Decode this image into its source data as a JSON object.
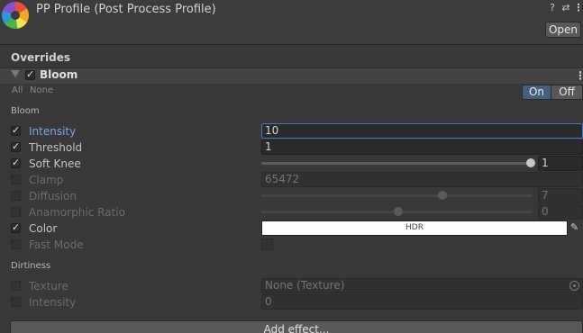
{
  "header": {
    "title": "PP Profile (Post Process Profile)",
    "open_label": "Open",
    "icons": [
      "help-icon",
      "settings-sliders-icon",
      "kebab-menu-icon"
    ]
  },
  "overrides_label": "Overrides",
  "effect": {
    "name": "Bloom",
    "enabled": true,
    "all_label": "All",
    "none_label": "None",
    "on_label": "On",
    "off_label": "Off",
    "state": "On"
  },
  "sections": {
    "bloom": "Bloom",
    "dirtiness": "Dirtiness"
  },
  "bloom_props": {
    "intensity": {
      "label": "Intensity",
      "value": "10",
      "checked": true
    },
    "threshold": {
      "label": "Threshold",
      "value": "1",
      "checked": true
    },
    "soft_knee": {
      "label": "Soft Knee",
      "value": "1",
      "checked": true,
      "slider_fraction": 1.0
    },
    "clamp": {
      "label": "Clamp",
      "value": "65472",
      "checked": false
    },
    "diffusion": {
      "label": "Diffusion",
      "value": "7",
      "checked": false,
      "slider_fraction": 0.667
    },
    "anamorphic": {
      "label": "Anamorphic Ratio",
      "value": "0",
      "checked": false,
      "slider_fraction": 0.5
    },
    "color": {
      "label": "Color",
      "value": "HDR",
      "checked": true,
      "swatch": "#ffffff"
    },
    "fast_mode": {
      "label": "Fast Mode",
      "checked": false
    }
  },
  "dirt_props": {
    "texture": {
      "label": "Texture",
      "value": "None (Texture)",
      "checked": false
    },
    "intensity": {
      "label": "Intensity",
      "value": "0",
      "checked": false
    }
  },
  "add_effect_label": "Add effect...",
  "colors": {
    "background": "#383838",
    "accent_on": "#46607c",
    "highlight_label": "#7aa6e6"
  }
}
